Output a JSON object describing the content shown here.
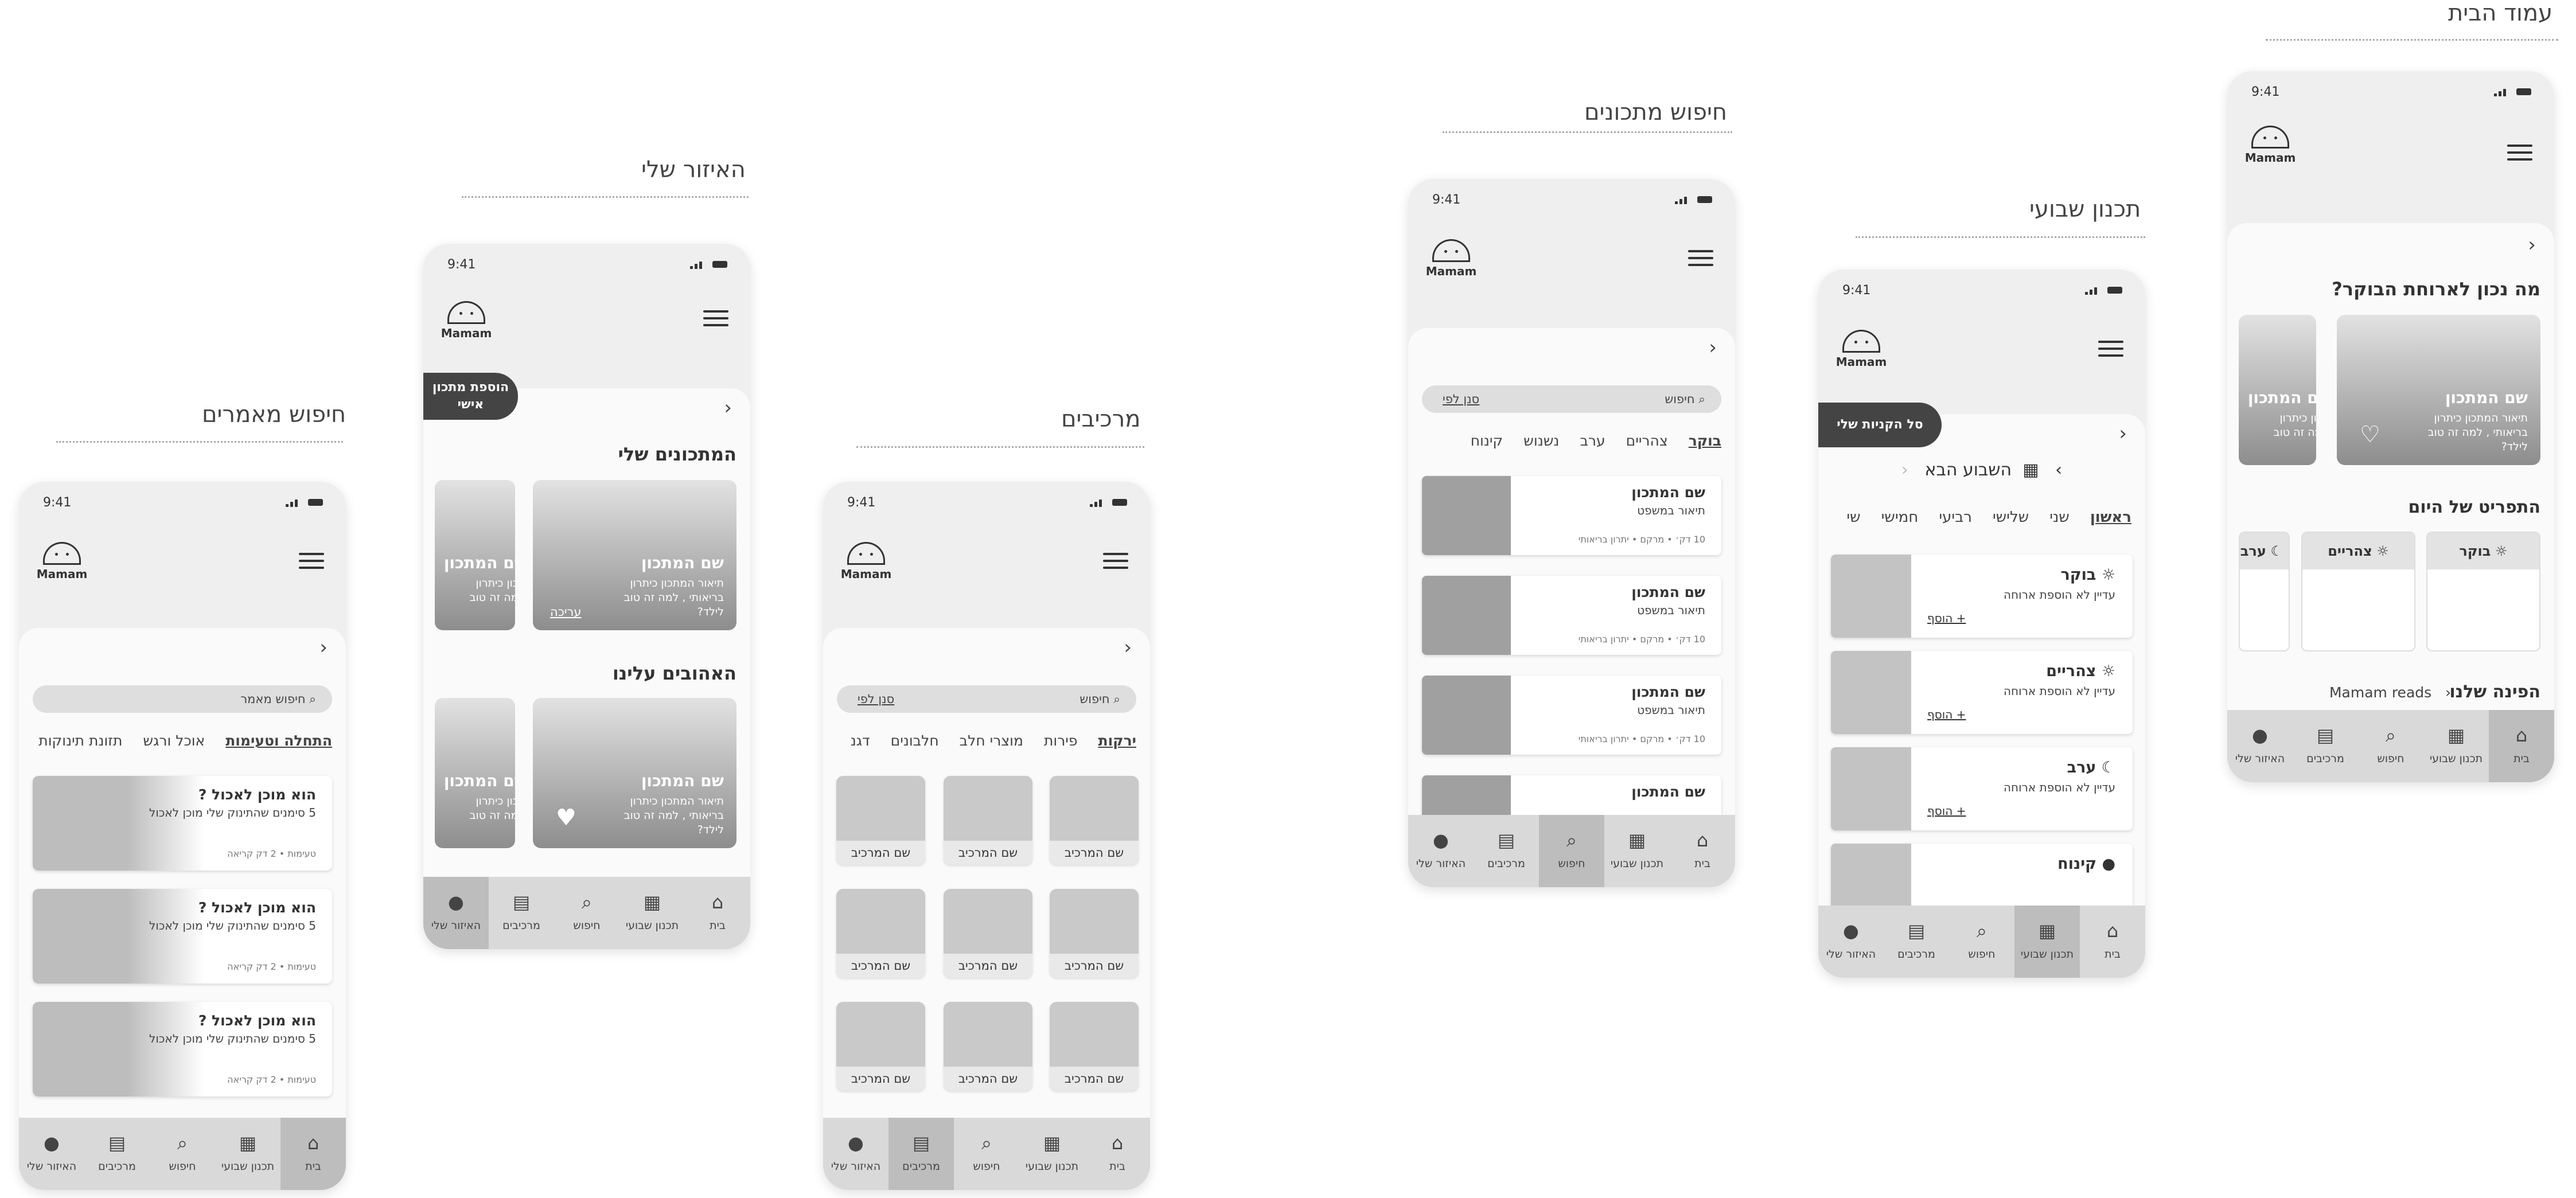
{
  "sections": {
    "home": "עמוד הבית",
    "weekly": "תכנון שבועי",
    "recipe_search": "חיפוש מתכונים",
    "ingredients": "מרכיבים",
    "my_area": "האיזור שלי",
    "article_search": "חיפוש מאמרים"
  },
  "status": {
    "time": "9:41"
  },
  "logo": {
    "text": "Mamam"
  },
  "nav": {
    "home": "בית",
    "weekly": "תכנון שבועי",
    "search": "חיפוש",
    "ingredients": "מרכיבים",
    "my_area": "האיזור שלי"
  },
  "home": {
    "question": "מה נכון לארוחת הבוקר?",
    "card_title": "שם המתכון",
    "card_desc": "תיאור המתכון כיתרון בריאותי , למה זה טוב לילד?",
    "today_menu": "התפריט של היום",
    "meals": [
      "בוקר",
      "צהריים",
      "ערב"
    ],
    "corner": "הפינה שלנו",
    "mamam_reads": "Mamam reads"
  },
  "weekly": {
    "basket": "סל הקניות שלי",
    "week": "השבוע הבא",
    "days": [
      "ראשון",
      "שני",
      "שלישי",
      "רביעי",
      "חמישי",
      "שי"
    ],
    "meals": [
      {
        "name": "בוקר",
        "empty": "עדיין לא הוספת ארוחה",
        "add": "+ הוסף"
      },
      {
        "name": "צהריים",
        "empty": "עדיין לא הוספת ארוחה",
        "add": "+ הוסף"
      },
      {
        "name": "ערב",
        "empty": "עדיין לא הוספת ארוחה",
        "add": "+ הוסף"
      },
      {
        "name": "קינוח"
      }
    ]
  },
  "recipe_search": {
    "search": "חיפוש",
    "filter": "סנן לפי",
    "chips": [
      "בוקר",
      "צהריים",
      "ערב",
      "נשנוש",
      "קינוח"
    ],
    "card_title": "שם המתכון",
    "card_desc": "תיאור במשפט",
    "card_meta": "10 דק׳ • מרקם • יתרון בריאותי"
  },
  "ingredients": {
    "search": "חיפוש",
    "filter": "סנן לפי",
    "chips": [
      "ירקות",
      "פירות",
      "מוצרי חלב",
      "חלבונים",
      "דגנ"
    ],
    "card": "שם המרכיב"
  },
  "my_area": {
    "add_recipe": "הוספת מתכון אישי",
    "my_recipes": "המתכונים שלי",
    "favorites": "האהובים עלינו",
    "card_title": "שם המתכון",
    "card_desc": "תיאור המתכון כיתרון בריאותי , למה זה טוב לילד?",
    "edit": "עריכה"
  },
  "article_search": {
    "search": "חיפוש מאמר",
    "chips": [
      "התחלה וטעימות",
      "אוכל ורגש",
      "תזונת תינוקות"
    ],
    "card_title": "הוא מוכן לאכול ?",
    "card_desc": "5 סימנים שהתינוק שלי מוכן לאכול",
    "card_meta": "טעימות • 2 דק קריאה"
  }
}
